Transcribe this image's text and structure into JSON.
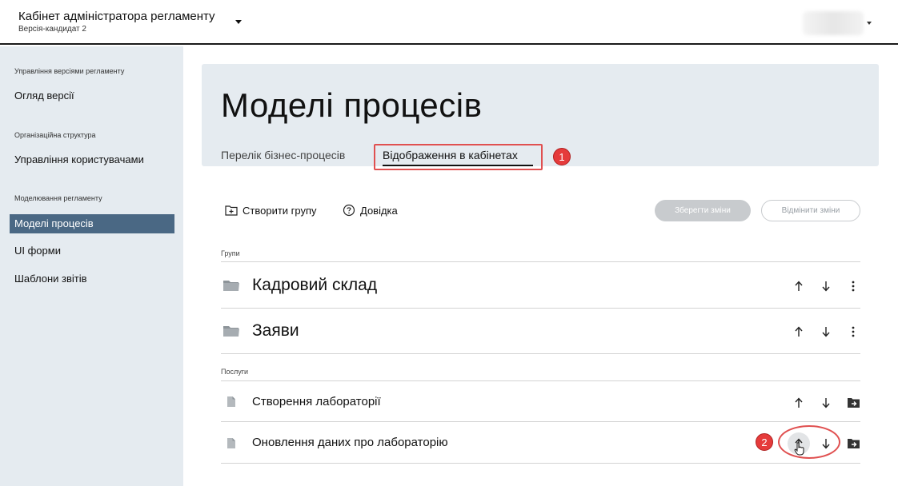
{
  "header": {
    "title": "Кабінет адміністратора регламенту",
    "subtitle": "Версія-кандидат 2"
  },
  "sidebar": {
    "sections": [
      {
        "label": "Управління версіями регламенту"
      },
      {
        "label": "Організаційна структура"
      },
      {
        "label": "Моделювання регламенту"
      }
    ],
    "items": [
      {
        "label": "Огляд версії"
      },
      {
        "label": "Управління користувачами"
      },
      {
        "label": "Моделі процесів"
      },
      {
        "label": "UI форми"
      },
      {
        "label": "Шаблони звітів"
      }
    ]
  },
  "main": {
    "title": "Моделі процесів",
    "tabs": [
      {
        "label": "Перелік бізнес-процесів"
      },
      {
        "label": "Відображення в кабінетах"
      }
    ],
    "toolbar": {
      "create_group": "Створити групу",
      "help": "Довідка",
      "save": "Зберегти зміни",
      "cancel": "Відмінити зміни"
    },
    "groups_label": "Групи",
    "groups": [
      {
        "name": "Кадровий склад"
      },
      {
        "name": "Заяви"
      }
    ],
    "services_label": "Послуги",
    "services": [
      {
        "name": "Створення лабораторії"
      },
      {
        "name": "Оновлення даних про лабораторію"
      }
    ]
  },
  "annotations": {
    "badge1": "1",
    "badge2": "2",
    "color": "#e53b3b"
  },
  "icons": [
    "folder-icon",
    "file-icon",
    "arrow-up-icon",
    "arrow-down-icon",
    "more-vert-icon",
    "move-to-folder-icon",
    "create-folder-icon",
    "help-icon",
    "hand-cursor-icon"
  ]
}
